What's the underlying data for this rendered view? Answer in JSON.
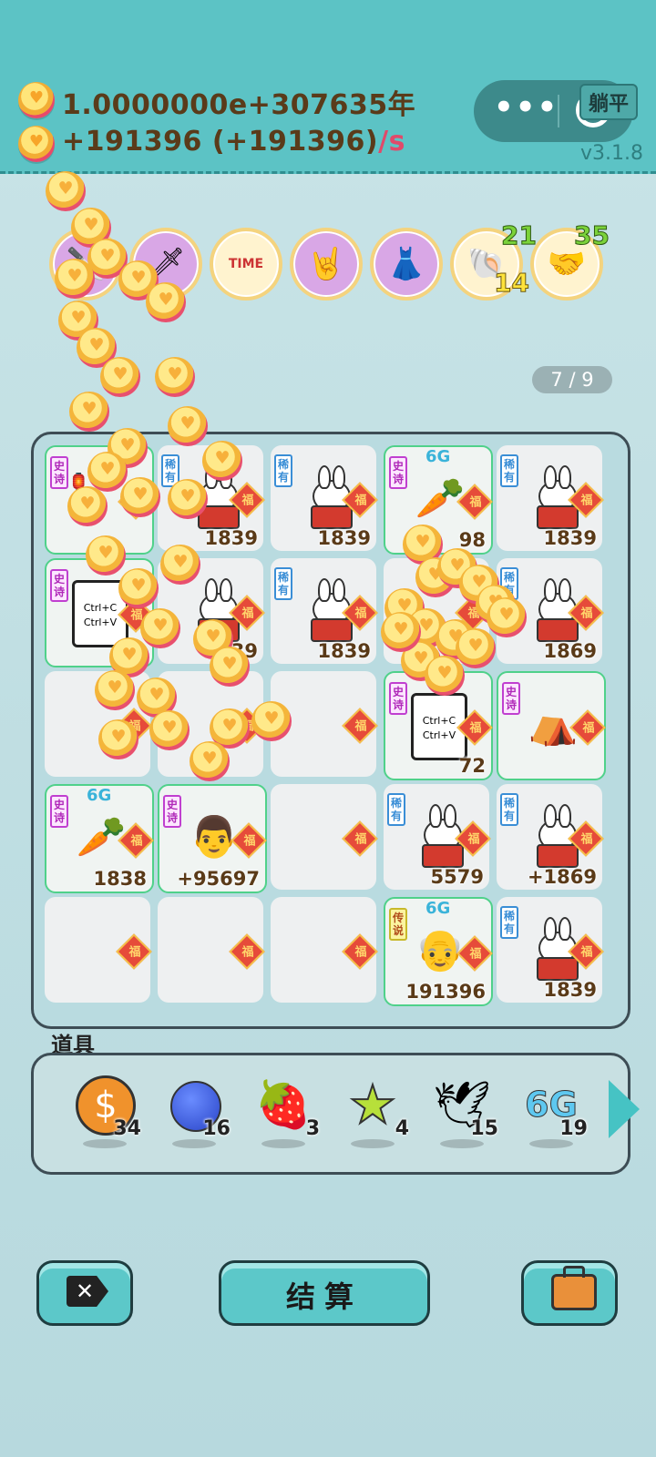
{
  "header": {
    "total_coins": "1.0000000e+307635年",
    "income_text": "+191396 (+191396)",
    "income_suffix": "/s",
    "mode_button": "躺平",
    "version": "v3.1.8",
    "menu_dots": "•••"
  },
  "badges": [
    {
      "icon": "chopper-icon"
    },
    {
      "icon": "cleaver-icon"
    },
    {
      "icon": "time-magazine-icon",
      "text": "TIME"
    },
    {
      "icon": "rock-hand-icon"
    },
    {
      "icon": "skirt-icon"
    },
    {
      "icon": "shell-icon",
      "top_count": "21",
      "bottom_count": "14"
    },
    {
      "icon": "handshake-icon",
      "top_count": "35"
    }
  ],
  "page_indicator": "7 / 9",
  "board": {
    "fu_label": "福",
    "cells": [
      {
        "row": 0,
        "col": 0,
        "rarity": "史诗",
        "kind": "lantern",
        "value": ""
      },
      {
        "row": 0,
        "col": 1,
        "rarity": "稀有",
        "kind": "bunny",
        "value": "1839"
      },
      {
        "row": 0,
        "col": 2,
        "rarity": "稀有",
        "kind": "bunny",
        "value": "1839"
      },
      {
        "row": 0,
        "col": 3,
        "rarity": "史诗",
        "kind": "carrot",
        "value": "98",
        "crown": "6G"
      },
      {
        "row": 0,
        "col": 4,
        "rarity": "稀有",
        "kind": "bunny",
        "value": "1839"
      },
      {
        "row": 1,
        "col": 0,
        "rarity": "史诗",
        "kind": "ctrl",
        "value": "",
        "text1": "Ctrl+C",
        "text2": "Ctrl+V"
      },
      {
        "row": 1,
        "col": 1,
        "rarity": "",
        "kind": "bunny",
        "value": "1839"
      },
      {
        "row": 1,
        "col": 2,
        "rarity": "稀有",
        "kind": "bunny",
        "value": "1839"
      },
      {
        "row": 1,
        "col": 3,
        "rarity": "",
        "kind": "empty",
        "value": ""
      },
      {
        "row": 1,
        "col": 4,
        "rarity": "稀有",
        "kind": "bunny",
        "value": "1869"
      },
      {
        "row": 2,
        "col": 0,
        "rarity": "",
        "kind": "empty",
        "value": ""
      },
      {
        "row": 2,
        "col": 1,
        "rarity": "",
        "kind": "empty",
        "value": ""
      },
      {
        "row": 2,
        "col": 2,
        "rarity": "",
        "kind": "empty",
        "value": ""
      },
      {
        "row": 2,
        "col": 3,
        "rarity": "史诗",
        "kind": "ctrl",
        "value": "72",
        "text1": "Ctrl+C",
        "text2": "Ctrl+V"
      },
      {
        "row": 2,
        "col": 4,
        "rarity": "史诗",
        "kind": "tent",
        "value": ""
      },
      {
        "row": 3,
        "col": 0,
        "rarity": "史诗",
        "kind": "carrot",
        "value": "1838",
        "crown": "6G"
      },
      {
        "row": 3,
        "col": 1,
        "rarity": "史诗",
        "kind": "boss",
        "value": "+95697"
      },
      {
        "row": 3,
        "col": 2,
        "rarity": "",
        "kind": "empty",
        "value": ""
      },
      {
        "row": 3,
        "col": 3,
        "rarity": "稀有",
        "kind": "bigbunny",
        "value": "5579"
      },
      {
        "row": 3,
        "col": 4,
        "rarity": "稀有",
        "kind": "bunny",
        "value": "+1869"
      },
      {
        "row": 4,
        "col": 0,
        "rarity": "",
        "kind": "empty",
        "value": ""
      },
      {
        "row": 4,
        "col": 1,
        "rarity": "",
        "kind": "empty",
        "value": ""
      },
      {
        "row": 4,
        "col": 2,
        "rarity": "",
        "kind": "empty",
        "value": ""
      },
      {
        "row": 4,
        "col": 3,
        "rarity": "传说",
        "kind": "king",
        "value": "191396",
        "crown": "6G"
      },
      {
        "row": 4,
        "col": 4,
        "rarity": "稀有",
        "kind": "bunny",
        "value": "1839"
      }
    ]
  },
  "items": {
    "title": "道具",
    "list": [
      {
        "icon": "dollar-coin-icon",
        "glyph": "$",
        "count": "34"
      },
      {
        "icon": "blueberry-icon",
        "glyph": "",
        "count": "16"
      },
      {
        "icon": "strawberry-icon",
        "glyph": "🍓",
        "count": "3"
      },
      {
        "icon": "star-icon",
        "glyph": "★",
        "count": "4"
      },
      {
        "icon": "pigeon-icon",
        "glyph": "🕊",
        "count": "15"
      },
      {
        "icon": "6g-icon",
        "glyph": "6G",
        "count": "19"
      }
    ]
  },
  "buttons": {
    "settle_label": "结算"
  }
}
